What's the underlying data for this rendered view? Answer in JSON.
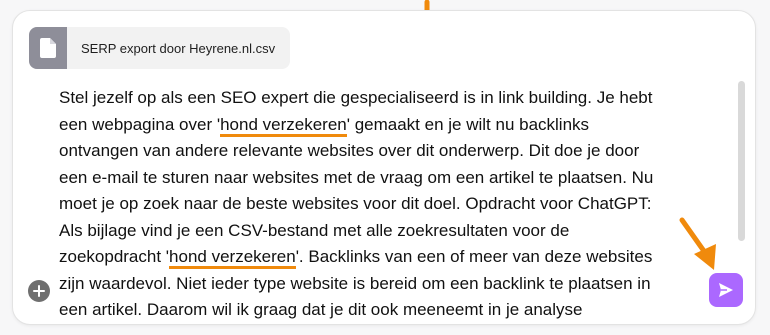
{
  "attachment": {
    "filename": "SERP export door Heyrene.nl.csv",
    "icon": "document-icon"
  },
  "message": {
    "line1": "Stel jezelf op als een SEO expert die gespecialiseerd is in link building. Je hebt",
    "line2_pre": "een webpagina over '",
    "highlight1": "hond verzekeren",
    "line2_post": "' gemaakt en je wilt nu backlinks",
    "line3": "ontvangen van andere relevante websites over dit onderwerp. Dit doe je door",
    "line4": "een e-mail te sturen naar websites met de vraag om een artikel te plaatsen. Nu",
    "line5": "moet je op zoek naar de beste websites voor dit doel. Opdracht voor ChatGPT:",
    "line6": "Als bijlage vind je een CSV-bestand met alle zoekresultaten voor de",
    "line7_pre": "zoekopdracht '",
    "highlight2": "hond verzekeren",
    "line7_post": "'. Backlinks van een of meer van deze websites",
    "line8": "zijn waardevol. Niet ieder type website is bereid om een backlink te plaatsen in",
    "line9": "een artikel. Daarom wil ik graag dat je dit ook meeneemt in je analyse"
  },
  "buttons": {
    "attach_icon": "plus-icon",
    "send_icon": "send-icon"
  },
  "colors": {
    "accent_orange": "#f08a0c",
    "send_purple": "#ab68ff"
  }
}
